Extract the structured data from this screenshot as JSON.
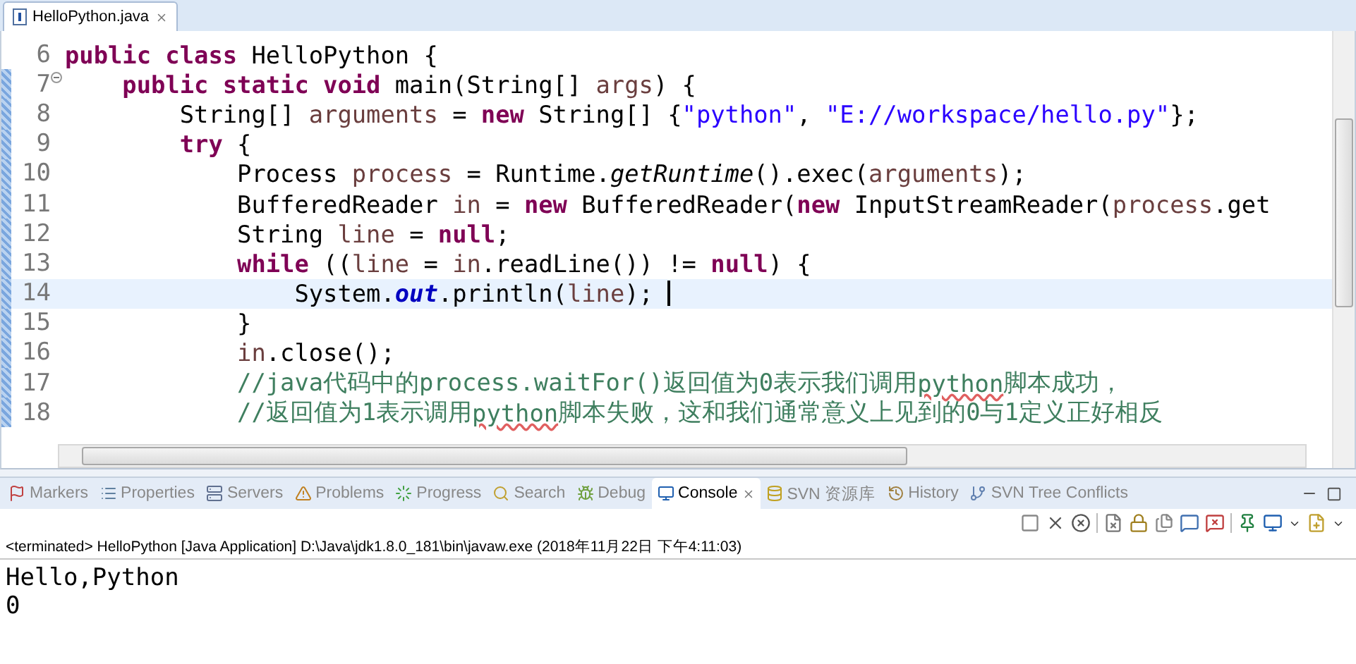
{
  "editor_tab": {
    "title": "HelloPython.java",
    "selected": true
  },
  "code_lines": [
    {
      "number": "6",
      "fold": false,
      "current": false,
      "changed": false,
      "tokens": [
        {
          "t": "public class ",
          "kind": "kw"
        },
        {
          "t": "HelloPython {",
          "kind": "plain"
        }
      ]
    },
    {
      "number": "7",
      "fold": true,
      "current": false,
      "changed": true,
      "tokens": [
        {
          "t": "    public static void ",
          "kind": "kw"
        },
        {
          "t": "main(String[] ",
          "kind": "plain"
        },
        {
          "t": "args",
          "kind": "var"
        },
        {
          "t": ") {",
          "kind": "plain"
        }
      ]
    },
    {
      "number": "8",
      "fold": false,
      "current": false,
      "changed": true,
      "tokens": [
        {
          "t": "        String[] ",
          "kind": "plain"
        },
        {
          "t": "arguments",
          "kind": "var"
        },
        {
          "t": " = ",
          "kind": "plain"
        },
        {
          "t": "new",
          "kind": "kw"
        },
        {
          "t": " String[] {",
          "kind": "plain"
        },
        {
          "t": "\"python\"",
          "kind": "str"
        },
        {
          "t": ", ",
          "kind": "plain"
        },
        {
          "t": "\"E://workspace/hello.py\"",
          "kind": "str"
        },
        {
          "t": "};",
          "kind": "plain"
        }
      ]
    },
    {
      "number": "9",
      "fold": false,
      "current": false,
      "changed": true,
      "tokens": [
        {
          "t": "        try",
          "kind": "kw"
        },
        {
          "t": " {",
          "kind": "plain"
        }
      ]
    },
    {
      "number": "10",
      "fold": false,
      "current": false,
      "changed": true,
      "tokens": [
        {
          "t": "            Process ",
          "kind": "plain"
        },
        {
          "t": "process",
          "kind": "var"
        },
        {
          "t": " = Runtime.",
          "kind": "plain"
        },
        {
          "t": "getRuntime",
          "kind": "static-method"
        },
        {
          "t": "().exec(",
          "kind": "plain"
        },
        {
          "t": "arguments",
          "kind": "var"
        },
        {
          "t": ");",
          "kind": "plain"
        }
      ]
    },
    {
      "number": "11",
      "fold": false,
      "current": false,
      "changed": true,
      "tokens": [
        {
          "t": "            BufferedReader ",
          "kind": "plain"
        },
        {
          "t": "in",
          "kind": "var"
        },
        {
          "t": " = ",
          "kind": "plain"
        },
        {
          "t": "new",
          "kind": "kw"
        },
        {
          "t": " BufferedReader(",
          "kind": "plain"
        },
        {
          "t": "new",
          "kind": "kw"
        },
        {
          "t": " InputStreamReader(",
          "kind": "plain"
        },
        {
          "t": "process",
          "kind": "var"
        },
        {
          "t": ".get",
          "kind": "plain"
        }
      ]
    },
    {
      "number": "12",
      "fold": false,
      "current": false,
      "changed": true,
      "tokens": [
        {
          "t": "            String ",
          "kind": "plain"
        },
        {
          "t": "line",
          "kind": "var"
        },
        {
          "t": " = ",
          "kind": "plain"
        },
        {
          "t": "null",
          "kind": "kw"
        },
        {
          "t": ";",
          "kind": "plain"
        }
      ]
    },
    {
      "number": "13",
      "fold": false,
      "current": false,
      "changed": true,
      "tokens": [
        {
          "t": "            while",
          "kind": "kw"
        },
        {
          "t": " ((",
          "kind": "plain"
        },
        {
          "t": "line",
          "kind": "var"
        },
        {
          "t": " = ",
          "kind": "plain"
        },
        {
          "t": "in",
          "kind": "var"
        },
        {
          "t": ".readLine()) != ",
          "kind": "plain"
        },
        {
          "t": "null",
          "kind": "kw"
        },
        {
          "t": ") {",
          "kind": "plain"
        }
      ]
    },
    {
      "number": "14",
      "fold": false,
      "current": true,
      "changed": true,
      "tokens": [
        {
          "t": "                System.",
          "kind": "plain"
        },
        {
          "t": "out",
          "kind": "static-field"
        },
        {
          "t": ".println(",
          "kind": "plain"
        },
        {
          "t": "line",
          "kind": "var"
        },
        {
          "t": "); ",
          "kind": "plain"
        }
      ]
    },
    {
      "number": "15",
      "fold": false,
      "current": false,
      "changed": true,
      "tokens": [
        {
          "t": "            }",
          "kind": "plain"
        }
      ]
    },
    {
      "number": "16",
      "fold": false,
      "current": false,
      "changed": true,
      "tokens": [
        {
          "t": "            in",
          "kind": "var"
        },
        {
          "t": ".close();",
          "kind": "plain"
        }
      ]
    },
    {
      "number": "17",
      "fold": false,
      "current": false,
      "changed": true,
      "tokens": [
        {
          "t": "            //java代码中的process.waitFor()返回值为0表示我们调用",
          "kind": "comment"
        },
        {
          "t": "python",
          "kind": "comment",
          "misspelled": true
        },
        {
          "t": "脚本成功，",
          "kind": "comment"
        }
      ]
    },
    {
      "number": "18",
      "fold": false,
      "current": false,
      "changed": true,
      "tokens": [
        {
          "t": "            //返回值为1表示调用",
          "kind": "comment"
        },
        {
          "t": "python",
          "kind": "comment",
          "misspelled": true
        },
        {
          "t": "脚本失败，这和我们通常意义上见到的0与1定义正好相反",
          "kind": "comment"
        }
      ]
    }
  ],
  "panel_tabs": [
    {
      "label": "Markers",
      "kind": "flag",
      "selected": false
    },
    {
      "label": "Properties",
      "kind": "list",
      "selected": false
    },
    {
      "label": "Servers",
      "kind": "server",
      "selected": false
    },
    {
      "label": "Problems",
      "kind": "warning",
      "selected": false
    },
    {
      "label": "Progress",
      "kind": "progress",
      "selected": false
    },
    {
      "label": "Search",
      "kind": "search",
      "selected": false
    },
    {
      "label": "Debug",
      "kind": "bug",
      "selected": false
    },
    {
      "label": "Console",
      "kind": "monitor",
      "selected": true
    },
    {
      "label": "SVN 资源库",
      "kind": "database",
      "selected": false
    },
    {
      "label": "History",
      "kind": "history",
      "selected": false
    },
    {
      "label": "SVN Tree Conflicts",
      "kind": "branch",
      "selected": false
    }
  ],
  "console": {
    "header": "<terminated> HelloPython [Java Application] D:\\Java\\jdk1.8.0_181\\bin\\javaw.exe (2018年11月22日 下午4:11:03)",
    "output": [
      "Hello,Python",
      "0"
    ]
  }
}
